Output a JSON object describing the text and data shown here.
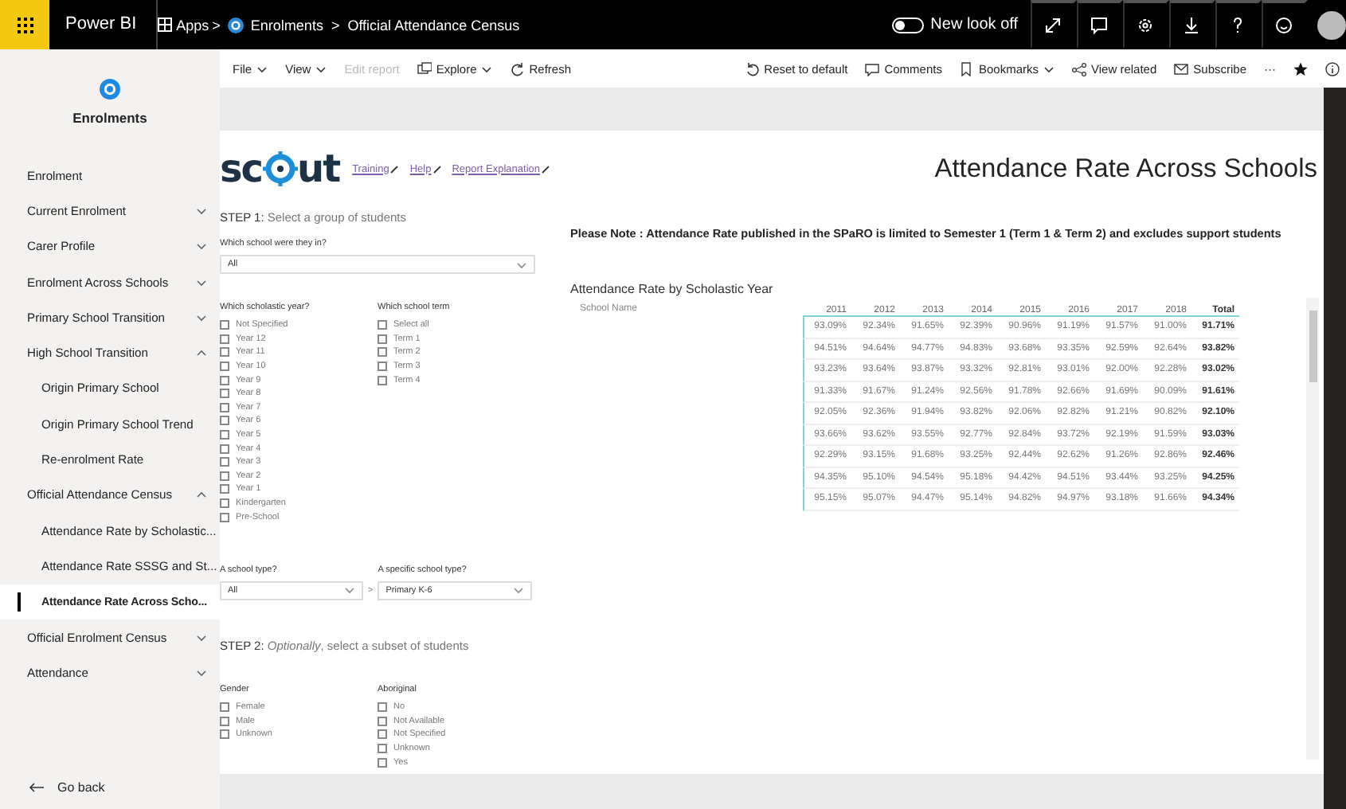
{
  "topbar": {
    "product": "Power BI",
    "apps": "Apps",
    "separators": [
      ">",
      ">"
    ],
    "breadcrumb": [
      {
        "label": "Enrolments",
        "kind": "app"
      },
      {
        "label": "Official Attendance Census",
        "kind": "page"
      }
    ],
    "new_look": {
      "label": "New look off",
      "on": false
    }
  },
  "toolbar": {
    "left": [
      {
        "label": "File",
        "kind": "menu",
        "disabled": false
      },
      {
        "label": "View",
        "kind": "menu",
        "disabled": false
      },
      {
        "label": "Edit report",
        "kind": "plain",
        "disabled": true
      },
      {
        "label": "Explore",
        "kind": "explore",
        "disabled": false
      },
      {
        "label": "Refresh",
        "kind": "refresh",
        "disabled": false
      }
    ],
    "right": [
      {
        "label": "Reset to default",
        "kind": "reset"
      },
      {
        "label": "Comments",
        "kind": "comment"
      },
      {
        "label": "Bookmarks",
        "kind": "bookmark"
      },
      {
        "label": "View related",
        "kind": "related"
      },
      {
        "label": "Subscribe",
        "kind": "mail"
      },
      {
        "label": "···",
        "kind": "more"
      }
    ]
  },
  "sidebar": {
    "title": "Enrolments",
    "items": [
      {
        "label": "Enrolment",
        "kind": "link",
        "selected": false
      },
      {
        "label": "Current Enrolment",
        "kind": "group",
        "expanded": false,
        "selected": false
      },
      {
        "label": "Carer Profile",
        "kind": "group",
        "expanded": false,
        "selected": false
      },
      {
        "label": "Enrolment Across Schools",
        "kind": "group",
        "expanded": false,
        "selected": false
      },
      {
        "label": "Primary School Transition",
        "kind": "group",
        "expanded": false,
        "selected": false
      },
      {
        "label": "High School Transition",
        "kind": "group",
        "expanded": true,
        "selected": false,
        "children": [
          {
            "label": "Origin Primary School",
            "selected": false
          },
          {
            "label": "Origin Primary School Trend",
            "selected": false
          },
          {
            "label": "Re-enrolment Rate",
            "selected": false
          }
        ]
      },
      {
        "label": "Official Attendance Census",
        "kind": "group",
        "expanded": true,
        "selected": false,
        "children": [
          {
            "label": "Attendance Rate by Scholastic...",
            "selected": false
          },
          {
            "label": "Attendance Rate SSSG and St...",
            "selected": false
          },
          {
            "label": "Attendance Rate Across Scho...",
            "selected": true
          }
        ]
      },
      {
        "label": "Official Enrolment Census",
        "kind": "group",
        "expanded": false,
        "selected": false
      },
      {
        "label": "Attendance",
        "kind": "group",
        "expanded": false,
        "selected": false
      }
    ],
    "back": "Go back"
  },
  "report": {
    "logo": "sc",
    "logo_end": "ut",
    "links": [
      "Training",
      "Help",
      "Report Explanation"
    ],
    "title": "Attendance Rate Across Schools",
    "step1": {
      "step": "STEP 1:",
      "text": "Select a group of students"
    },
    "school_filter": {
      "label": "Which school were they in?",
      "value": "All"
    },
    "year_filter": {
      "label": "Which scholastic year?",
      "options": [
        {
          "label": "Not Specified",
          "checked": false
        },
        {
          "label": "Year 12",
          "checked": false
        },
        {
          "label": "Year 11",
          "checked": false
        },
        {
          "label": "Year 10",
          "checked": false
        },
        {
          "label": "Year 9",
          "checked": false
        },
        {
          "label": "Year 8",
          "checked": false
        },
        {
          "label": "Year 7",
          "checked": false
        },
        {
          "label": "Year 6",
          "checked": false
        },
        {
          "label": "Year 5",
          "checked": false
        },
        {
          "label": "Year 4",
          "checked": false
        },
        {
          "label": "Year 3",
          "checked": false
        },
        {
          "label": "Year 2",
          "checked": false
        },
        {
          "label": "Year 1",
          "checked": false
        },
        {
          "label": "Kindergarten",
          "checked": false
        },
        {
          "label": "Pre-School",
          "checked": false
        }
      ]
    },
    "term_filter": {
      "label": "Which school term",
      "options": [
        {
          "label": "Select all",
          "checked": false
        },
        {
          "label": "Term 1",
          "checked": false
        },
        {
          "label": "Term 2",
          "checked": false
        },
        {
          "label": "Term 3",
          "checked": false
        },
        {
          "label": "Term 4",
          "checked": false
        }
      ]
    },
    "type_filter": {
      "label": "A school type?",
      "value": "All"
    },
    "separator": ">",
    "specific_type_filter": {
      "label": "A specific school type?",
      "value": "Primary K-6"
    },
    "step2": {
      "step": "STEP 2:",
      "text": "*Optionally*, select a subset of students"
    },
    "gender_filter": {
      "label": "Gender",
      "options": [
        {
          "label": "Female",
          "checked": false
        },
        {
          "label": "Male",
          "checked": false
        },
        {
          "label": "Unknown",
          "checked": false
        }
      ]
    },
    "aboriginal_filter": {
      "label": "Aboriginal",
      "options": [
        {
          "label": "No",
          "checked": false
        },
        {
          "label": "Not Available",
          "checked": false
        },
        {
          "label": "Not Specified",
          "checked": false
        },
        {
          "label": "Unknown",
          "checked": false
        },
        {
          "label": "Yes",
          "checked": false
        }
      ]
    },
    "note": "Please Note : Attendance Rate published in the SPaRO is limited to Semester 1 (Term 1 & Term 2) and excludes support students",
    "table": {
      "title": "Attendance Rate by Scholastic Year",
      "columns": [
        "School Name",
        "2011",
        "2012",
        "2013",
        "2014",
        "2015",
        "2016",
        "2017",
        "2018",
        "Total"
      ],
      "rows": [
        [
          "",
          "93.09%",
          "92.34%",
          "91.65%",
          "92.39%",
          "90.96%",
          "91.19%",
          "91.57%",
          "91.00%",
          "91.71%"
        ],
        [
          "",
          "94.51%",
          "94.64%",
          "94.77%",
          "94.83%",
          "93.68%",
          "93.35%",
          "92.59%",
          "92.64%",
          "93.82%"
        ],
        [
          "",
          "93.23%",
          "93.64%",
          "93.87%",
          "93.32%",
          "92.81%",
          "93.01%",
          "92.00%",
          "92.28%",
          "93.02%"
        ],
        [
          "",
          "91.33%",
          "91.67%",
          "91.24%",
          "92.56%",
          "91.78%",
          "92.66%",
          "91.69%",
          "90.09%",
          "91.61%"
        ],
        [
          "",
          "92.05%",
          "92.36%",
          "91.94%",
          "93.82%",
          "92.06%",
          "92.82%",
          "91.21%",
          "90.82%",
          "92.10%"
        ],
        [
          "",
          "93.66%",
          "93.62%",
          "93.55%",
          "92.77%",
          "92.84%",
          "93.72%",
          "92.19%",
          "91.59%",
          "93.03%"
        ],
        [
          "",
          "92.29%",
          "93.15%",
          "91.68%",
          "93.25%",
          "92.44%",
          "92.62%",
          "91.26%",
          "92.86%",
          "92.46%"
        ],
        [
          "",
          "94.35%",
          "95.10%",
          "94.54%",
          "95.18%",
          "94.42%",
          "94.51%",
          "93.44%",
          "93.25%",
          "94.25%"
        ],
        [
          "",
          "95.15%",
          "95.07%",
          "94.47%",
          "95.14%",
          "94.82%",
          "94.97%",
          "93.18%",
          "91.66%",
          "94.34%"
        ]
      ]
    }
  }
}
